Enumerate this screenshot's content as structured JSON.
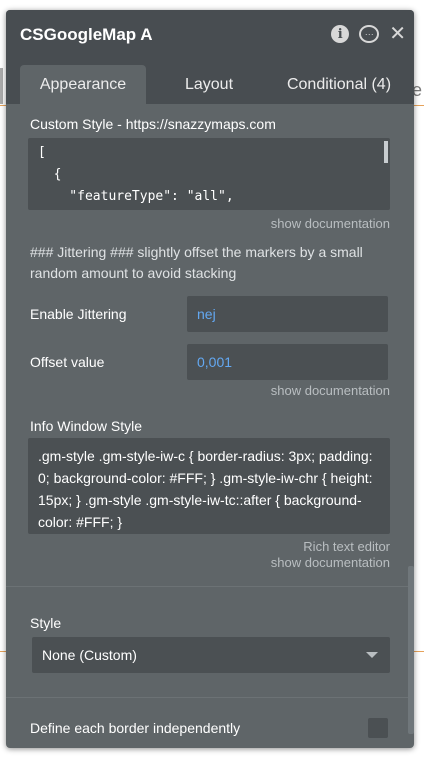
{
  "background": {
    "right_text": "e"
  },
  "window": {
    "title": "CSGoogleMap A"
  },
  "tabs": [
    {
      "label": "Appearance",
      "active": true
    },
    {
      "label": "Layout",
      "active": false
    },
    {
      "label": "Conditional (4)",
      "active": false
    }
  ],
  "custom_style": {
    "label": "Custom Style - https://snazzymaps.com",
    "lines": [
      "[",
      "  {",
      "    \"featureType\": \"all\","
    ],
    "doc_link": "show documentation"
  },
  "jittering": {
    "description": "### Jittering ### slightly offset the markers by a small random amount to avoid stacking",
    "enable_label": "Enable Jittering",
    "enable_value": "nej",
    "offset_label": "Offset value",
    "offset_value": "0,001",
    "doc_link": "show documentation"
  },
  "info_window": {
    "label": "Info Window Style",
    "value": ".gm-style .gm-style-iw-c {     border-radius: 3px; padding: 0;     background-color: #FFF; }  .gm-style-iw-chr {     height: 15px; }  .gm-style .gm-style-iw-tc::after {     background-color: #FFF; }",
    "rich_text_link": "Rich text editor",
    "doc_link": "show documentation"
  },
  "style_section": {
    "label": "Style",
    "selected": "None (Custom)"
  },
  "border_section": {
    "label": "Define each border independently"
  },
  "colors": {
    "panel_bg": "#5f6568",
    "header_bg": "#484d51",
    "input_bg": "#4b5053",
    "value_blue": "#63a8f2",
    "bg_accent_line": "#e6a25a"
  }
}
